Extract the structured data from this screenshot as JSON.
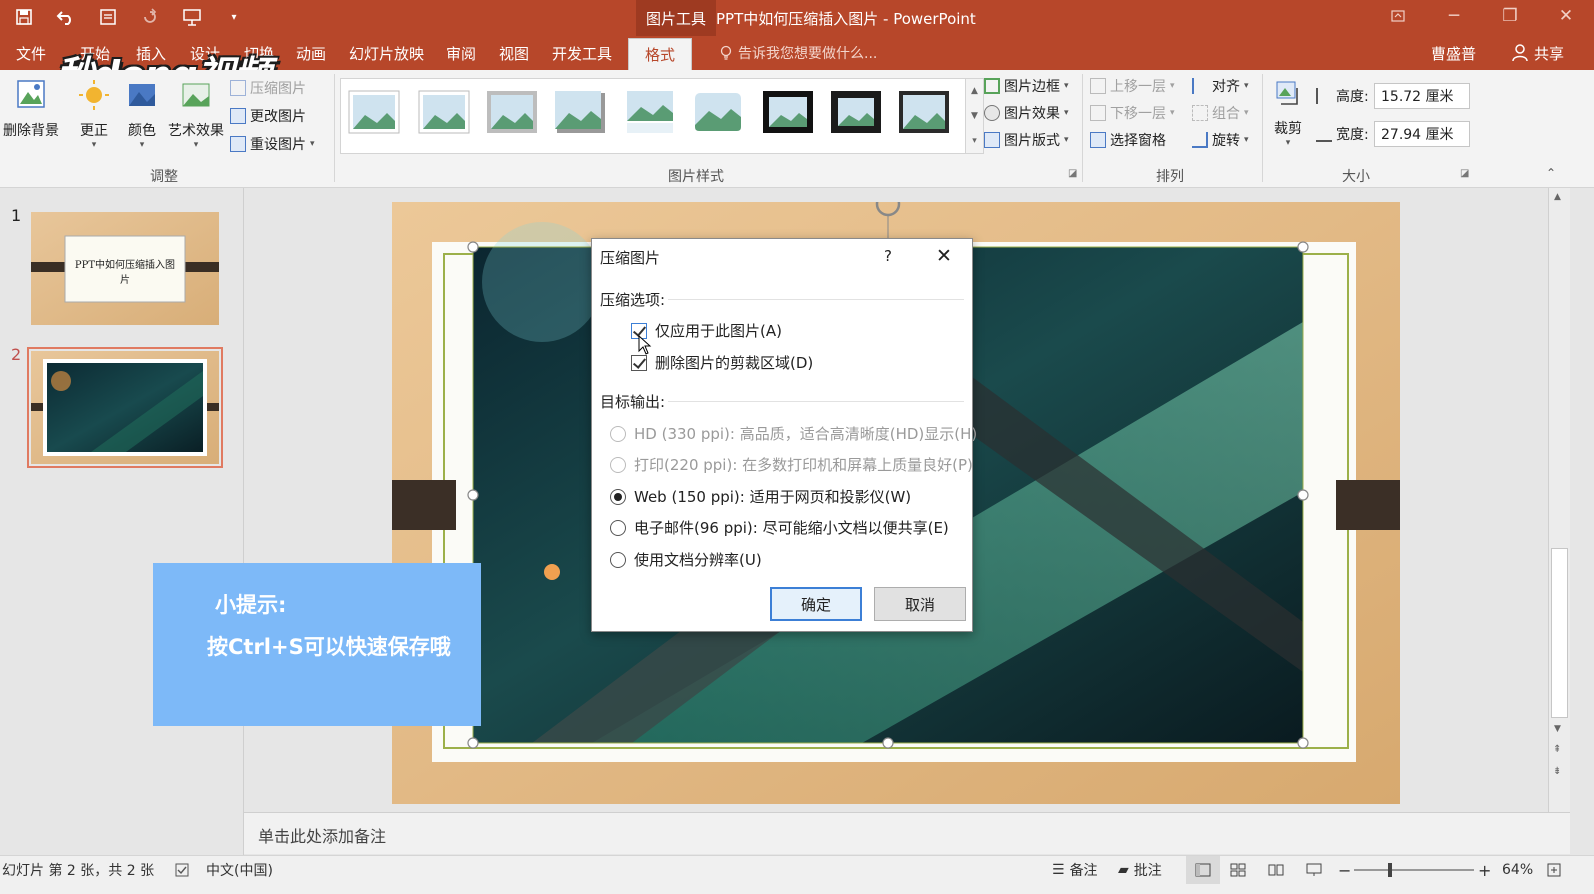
{
  "window": {
    "context_tab": "图片工具",
    "title": "PPT中如何压缩插入图片 - PowerPoint",
    "quick_access": [
      "save-icon",
      "undo-icon",
      "start-from-beginning-icon",
      "redo-icon",
      "presenter-icon",
      "customize-qat-icon"
    ]
  },
  "watermark": "秒dong视频",
  "tabs": [
    {
      "label": "文件"
    },
    {
      "label": "开始"
    },
    {
      "label": "插入"
    },
    {
      "label": "设计"
    },
    {
      "label": "切换"
    },
    {
      "label": "动画"
    },
    {
      "label": "幻灯片放映"
    },
    {
      "label": "审阅"
    },
    {
      "label": "视图"
    },
    {
      "label": "开发工具"
    },
    {
      "label": "格式"
    }
  ],
  "tellme": "告诉我您想要做什么...",
  "user": "曹盛普",
  "share": "共享",
  "ribbon": {
    "adjust": {
      "remove_bg": "删除背景",
      "corrections": "更正",
      "color": "颜色",
      "artistic": "艺术效果",
      "compress": "压缩图片",
      "change": "更改图片",
      "reset": "重设图片",
      "group_label": "调整"
    },
    "styles": {
      "group_label": "图片样式",
      "border": "图片边框",
      "effects": "图片效果",
      "layout": "图片版式"
    },
    "arrange": {
      "group_label": "排列",
      "bring_forward": "上移一层",
      "send_backward": "下移一层",
      "selection_pane": "选择窗格",
      "align": "对齐",
      "group": "组合",
      "rotate": "旋转"
    },
    "size": {
      "group_label": "大小",
      "crop": "裁剪",
      "height_label": "高度:",
      "height_value": "15.72 厘米",
      "width_label": "宽度:",
      "width_value": "27.94 厘米"
    }
  },
  "slides_panel": {
    "slides": [
      {
        "number": "1",
        "caption": "PPT中如何压缩插入图片"
      },
      {
        "number": "2"
      }
    ]
  },
  "tip": {
    "line1": "小提示:",
    "line2": "按Ctrl+S可以快速保存哦"
  },
  "dialog": {
    "title": "压缩图片",
    "help": "?",
    "close": "✕",
    "section_compress": "压缩选项:",
    "option_apply_only": "仅应用于此图片(A)",
    "option_delete_crop": "删除图片的剪裁区域(D)",
    "section_target": "目标输出:",
    "radio_hd": "HD (330 ppi): 高品质，适合高清晰度(HD)显示(H)",
    "radio_print": "打印(220 ppi): 在多数打印机和屏幕上质量良好(P)",
    "radio_web": "Web (150 ppi): 适用于网页和投影仪(W)",
    "radio_email": "电子邮件(96 ppi): 尽可能缩小文档以便共享(E)",
    "radio_doc": "使用文档分辨率(U)",
    "ok": "确定",
    "cancel": "取消"
  },
  "notes_placeholder": "单击此处添加备注",
  "status": {
    "slide_info": "幻灯片 第 2 张，共 2 张",
    "language": "中文(中国)",
    "notes": "备注",
    "comments": "批注",
    "zoom": "64%"
  },
  "colors": {
    "accent": "#b7472a",
    "tip": "#7db9f8"
  }
}
